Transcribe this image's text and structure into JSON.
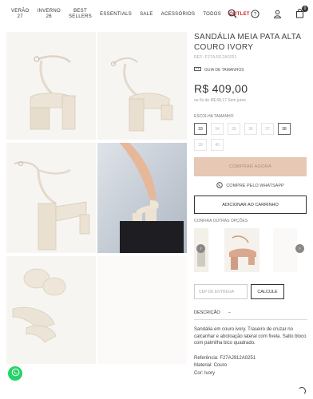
{
  "nav": {
    "items": [
      {
        "line1": "VERÃO",
        "line2": "27"
      },
      {
        "line1": "INVERNO",
        "line2": "26"
      },
      {
        "line1": "BEST",
        "line2": "SELLERS"
      },
      {
        "line1": "ESSENTIALS",
        "line2": ""
      },
      {
        "line1": "SALE",
        "line2": ""
      },
      {
        "line1": "ACESSÓRIOS",
        "line2": ""
      },
      {
        "line1": "TODOS",
        "line2": ""
      }
    ],
    "outlet": "OUTLET"
  },
  "header_icons": [
    "search-icon",
    "help-icon",
    "user-icon",
    "bag-icon"
  ],
  "cart_count": "0",
  "product": {
    "title": "SANDÁLIA MEIA PATA ALTA COURO IVORY",
    "ref": "REF: F27AJ912A0251",
    "size_guide": "GUIA DE TAMANHOS",
    "price": "R$ 409,00",
    "installments": "ou 6x de R$ 68,17 Sem juros",
    "size_label": "ESCOLHA TAMANHO",
    "sizes": [
      {
        "label": "33",
        "available": true
      },
      {
        "label": "34",
        "available": false
      },
      {
        "label": "35",
        "available": false
      },
      {
        "label": "36",
        "available": false
      },
      {
        "label": "37",
        "available": false
      },
      {
        "label": "38",
        "available": true
      },
      {
        "label": "39",
        "available": false
      },
      {
        "label": "40",
        "available": false
      }
    ],
    "buy_label": "COMPRAR AGORA",
    "whatsapp_label": "COMPRE PELO WHATSAPP",
    "cart_label": "ADICIONAR AO CARRINHO",
    "other_options_label": "CONFIRA OUTRAS OPÇÕES",
    "cep_placeholder": "CEP DE ENTREGA",
    "calc_label": "CALCULE",
    "desc_label": "DESCRIÇÃO",
    "desc_toggle": "−",
    "description": "Sandália em couro ivory. Traseiro de cruzar no calcanhar e abotoação lateral com fivela. Salto bloco com palmilha bico quadrado.",
    "specs": [
      {
        "label": "Referência",
        "value": "F27AJ912A0251"
      },
      {
        "label": "Material",
        "value": "Couro"
      },
      {
        "label": "Cor",
        "value": "Ivory"
      }
    ]
  },
  "colors": {
    "accent_buy": "#e6c8b5",
    "outlet": "#d32027",
    "whatsapp": "#25d366",
    "shoe": "#ece4d6"
  }
}
